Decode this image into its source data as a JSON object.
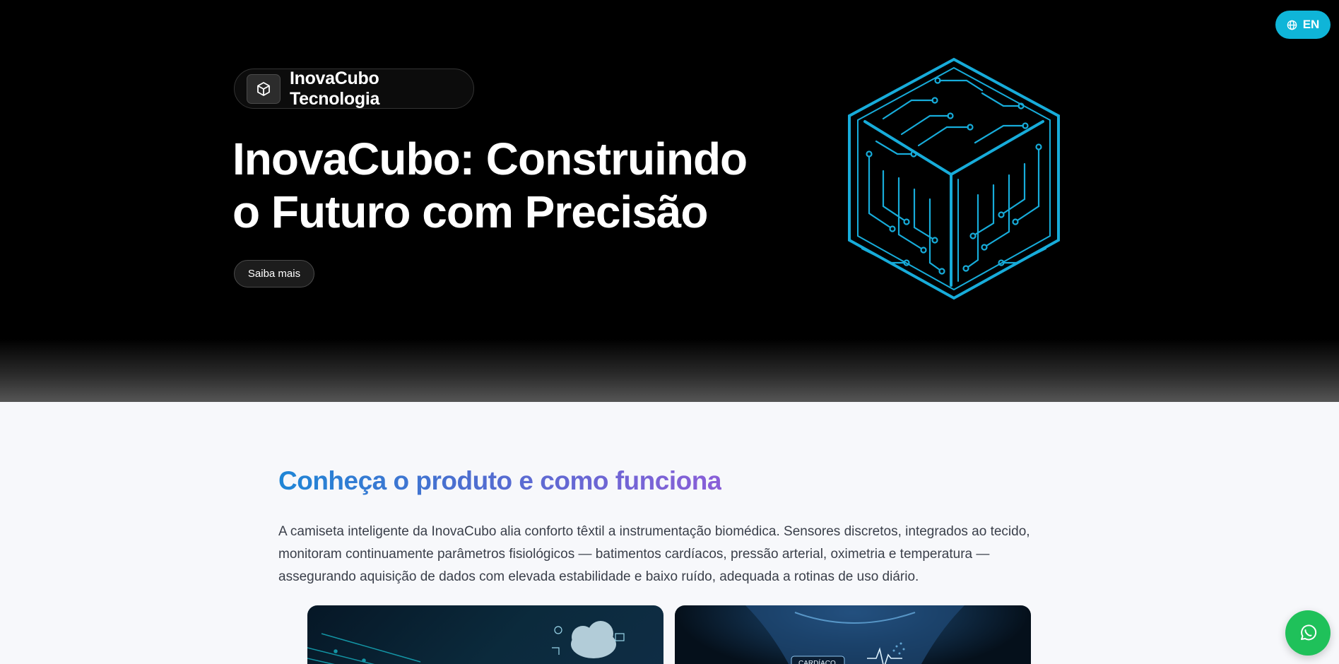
{
  "lang_switcher": {
    "label": "EN",
    "icon": "globe-icon"
  },
  "brand": {
    "name": "InovaCubo Tecnologia",
    "icon": "cube-icon"
  },
  "hero": {
    "title_line1": "InovaCubo: Construindo",
    "title_line2": "o Futuro com Precisão",
    "cta_label": "Saiba mais",
    "illustration": "circuit-cube-illustration"
  },
  "product": {
    "title": "Conheça o produto e como funciona",
    "description": "A camiseta inteligente da InovaCubo alia conforto têxtil a instrumentação biomédica. Sensores discretos, integrados ao tecido, monitoram continuamente parâmetros fisiológicos — batimentos cardíacos, pressão arterial, oximetria e temperatura — assegurando aquisição de dados com elevada estabilidade e baixo ruído, adequada a rotinas de uso diário.",
    "cards": [
      {
        "image": "cloud-data-image"
      },
      {
        "image": "smart-shirt-image",
        "overlay_text": "CARDÍACO"
      }
    ]
  },
  "whatsapp": {
    "icon": "whatsapp-icon"
  },
  "colors": {
    "accent": "#0fb5d8",
    "circuit": "#19b6e6",
    "title_gradient_start": "#1f86d6",
    "title_gradient_end": "#8a5fd8",
    "whatsapp": "#1fc15a"
  }
}
